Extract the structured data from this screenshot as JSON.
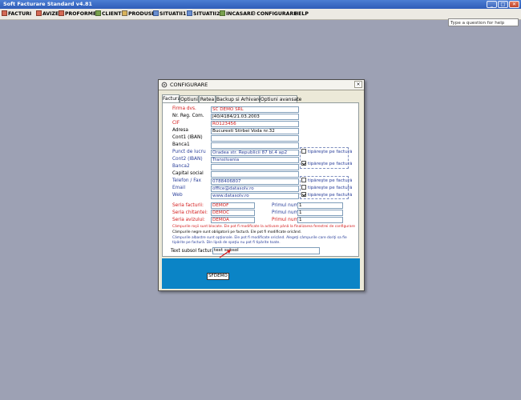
{
  "window": {
    "title": "Soft Facturare Standard v4.81",
    "buttons": [
      "_",
      "□",
      "✕"
    ],
    "help_placeholder": "Type a question for help"
  },
  "menu": [
    {
      "label": "FACTURI",
      "icon": "document-icon"
    },
    {
      "label": "AVIZE",
      "icon": "document-icon"
    },
    {
      "label": "PROFORME",
      "icon": "document-icon"
    },
    {
      "label": "CLIENTI",
      "icon": "people-icon"
    },
    {
      "label": "PRODUSE",
      "icon": "box-icon"
    },
    {
      "label": "SITUATII1",
      "icon": "report-icon"
    },
    {
      "label": "SITUATII2",
      "icon": "report-icon"
    },
    {
      "label": "INCASARI",
      "icon": "money-icon"
    },
    {
      "label": "CONFIGURARE",
      "icon": "gear-icon"
    },
    {
      "label": "HELP",
      "icon": ""
    }
  ],
  "dialog": {
    "title": "CONFIGURARE",
    "close": "×",
    "tabs": [
      "Factura",
      "Optiuni",
      "Retea",
      "Backup si Arhivare",
      "Optiuni avansate"
    ],
    "active_tab": "Factura",
    "fields": [
      {
        "label": "Firma dvs.",
        "value": "SC DEMO SRL",
        "label_color": "red",
        "value_color": "red"
      },
      {
        "label": "Nr. Reg. Com.",
        "value": "J40/4184/21.03.2003",
        "label_color": "black",
        "value_color": "black"
      },
      {
        "label": "CIF",
        "value": "RO123456",
        "label_color": "red",
        "value_color": "red"
      },
      {
        "label": "Adresa",
        "value": "Bucuresti Stirbei Voda nr.32",
        "label_color": "black",
        "value_color": "black"
      },
      {
        "label": "Cont1 (IBAN)",
        "value": "",
        "label_color": "black",
        "value_color": "black"
      },
      {
        "label": "Banca1",
        "value": "",
        "label_color": "black",
        "value_color": "black"
      },
      {
        "label": "Punct de lucru",
        "value": "Oradea str. Republicii 87 bl.4 ap2",
        "label_color": "blue",
        "value_color": "blue"
      },
      {
        "label": "Cont2 (IBAN)",
        "value": "Transilvania",
        "label_color": "blue",
        "value_color": "blue"
      },
      {
        "label": "Banca2",
        "value": "",
        "label_color": "blue",
        "value_color": "blue"
      },
      {
        "label": "Capital social",
        "value": "",
        "label_color": "black",
        "value_color": "black"
      },
      {
        "label": "Telefon / Fax",
        "value": "0788406807",
        "label_color": "blue",
        "value_color": "blue"
      },
      {
        "label": "Email",
        "value": "office@datasolv.ro",
        "label_color": "blue",
        "value_color": "blue"
      },
      {
        "label": "Web",
        "value": "www.datasolv.ro",
        "label_color": "blue",
        "value_color": "blue"
      }
    ],
    "checkboxes": [
      {
        "label": "tipăreşte pe factură",
        "checked": false
      },
      {
        "label": "tipăreşte pe factură",
        "checked": true
      },
      {
        "label": "tipăreşte pe factură",
        "checked": false
      },
      {
        "label": "tipăreşte pe factură",
        "checked": false
      },
      {
        "label": "tipăreşte pe factură",
        "checked": true
      }
    ],
    "series": [
      {
        "label": "Seria facturii:",
        "value": "DEMOF",
        "num_label": "Primul număr:",
        "num_value": "1"
      },
      {
        "label": "Seria chitantei:",
        "value": "DEMOC",
        "num_label": "Primul număr:",
        "num_value": "1"
      },
      {
        "label": "Seria avizului:",
        "value": "DEMOA",
        "num_label": "Primul număr:",
        "num_value": "1"
      }
    ],
    "notes": [
      {
        "text": "Câmpurile roşii sunt blocate. Ele pot fi modificate la activare până la finalizarea ferestrei de configurare",
        "color": "#d31a1a"
      },
      {
        "text": "Câmpurile negre sunt obligatorii pe factură. Ele pot fi modificate oricând.",
        "color": "#000000"
      },
      {
        "text": "Câmpurile albastre sunt opţionale. Ele pot fi modificate oricând. Alegeţi câmpurile care doriţi sa fie",
        "color": "#2a3f9a"
      },
      {
        "text": "tipărite pe factură. Din lipsă de spaţiu nu pot fi tipărite toate.",
        "color": "#2a3f9a"
      }
    ],
    "footer_label": "Text subsol factură:",
    "footer_value": "text subsol",
    "bottom_box_value": "SFDEMO"
  }
}
